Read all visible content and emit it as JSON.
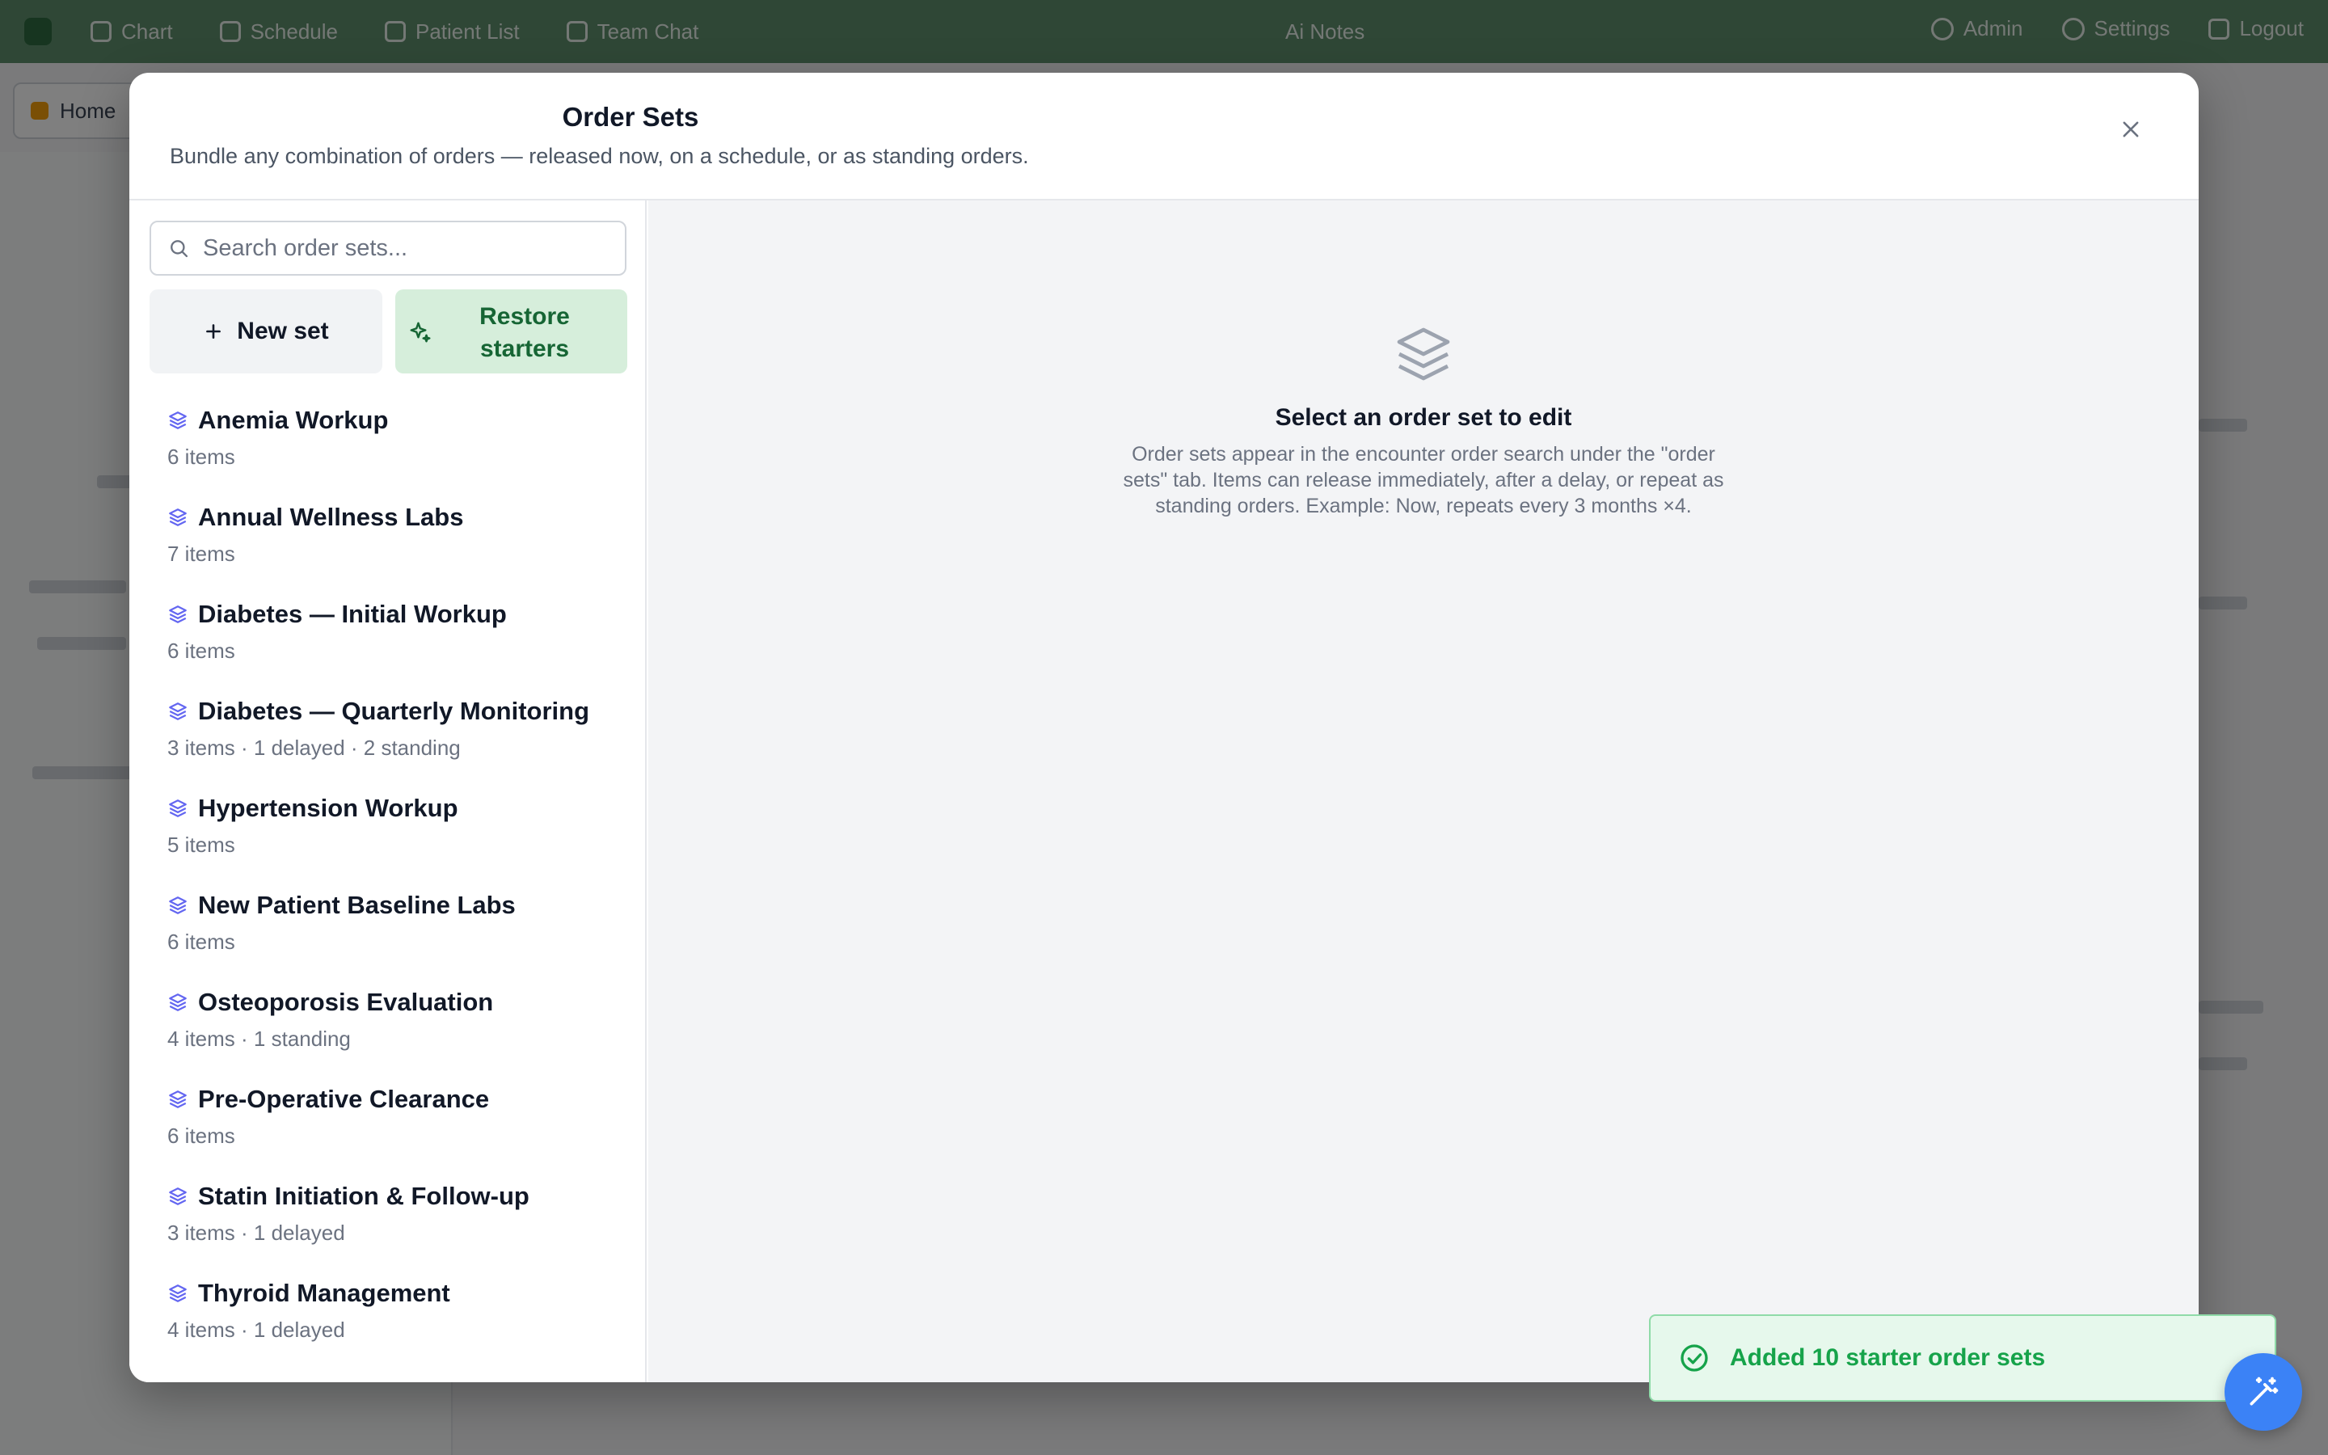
{
  "topnav": {
    "items": [
      "Chart",
      "Schedule",
      "Patient List",
      "Team Chat"
    ],
    "center": "Ai Notes",
    "right": [
      "Admin",
      "Settings",
      "Logout"
    ]
  },
  "background": {
    "home_tab": "Home"
  },
  "modal": {
    "title": "Order Sets",
    "subtitle": "Bundle any combination of orders — released now, on a schedule, or as standing orders."
  },
  "search": {
    "placeholder": "Search order sets..."
  },
  "buttons": {
    "new_set": "New set",
    "restore_line1": "Restore",
    "restore_line2": "starters"
  },
  "order_sets": [
    {
      "name": "Anemia Workup",
      "meta": "6 items"
    },
    {
      "name": "Annual Wellness Labs",
      "meta": "7 items"
    },
    {
      "name": "Diabetes — Initial Workup",
      "meta": "6 items"
    },
    {
      "name": "Diabetes — Quarterly Monitoring",
      "meta": "3 items · 1 delayed · 2 standing"
    },
    {
      "name": "Hypertension Workup",
      "meta": "5 items"
    },
    {
      "name": "New Patient Baseline Labs",
      "meta": "6 items"
    },
    {
      "name": "Osteoporosis Evaluation",
      "meta": "4 items · 1 standing"
    },
    {
      "name": "Pre-Operative Clearance",
      "meta": "6 items"
    },
    {
      "name": "Statin Initiation & Follow-up",
      "meta": "3 items · 1 delayed"
    },
    {
      "name": "Thyroid Management",
      "meta": "4 items · 1 delayed"
    }
  ],
  "empty_state": {
    "title": "Select an order set to edit",
    "description": "Order sets appear in the encounter order search under the \"order sets\" tab. Items can release immediately, after a delay, or repeat as standing orders. Example: Now, repeats every 3 months ×4."
  },
  "toast": {
    "message": "Added 10 starter order sets"
  },
  "icons": {
    "list_item": "layers-icon",
    "search": "search-icon",
    "new": "plus-icon",
    "restore": "sparkles-icon",
    "close": "close-icon",
    "empty": "layers-icon",
    "toast": "check-circle-icon",
    "fab": "magic-wand-icon"
  },
  "colors": {
    "accent_purple": "#6366f1",
    "success_green": "#16a34a",
    "restore_bg": "#d6eedb",
    "fab_blue": "#3b82f6"
  }
}
